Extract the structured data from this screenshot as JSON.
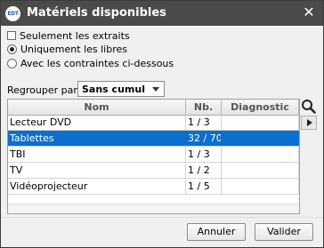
{
  "dialog": {
    "title": "Matériels disponibles",
    "app_icon_label": "EDT",
    "close_glyph": "✕"
  },
  "filters": {
    "only_extracts": {
      "label": "Seulement les extraits",
      "checked": false
    },
    "only_free": {
      "label": "Uniquement les libres",
      "selected": true
    },
    "with_constraints": {
      "label": "Avec les contraintes ci-dessous",
      "selected": false
    }
  },
  "grouping": {
    "label": "Regrouper par :",
    "selected": "Sans cumul"
  },
  "table": {
    "columns": [
      "Nom",
      "Nb.",
      "Diagnostic"
    ],
    "rows": [
      {
        "name": "Lecteur DVD",
        "nb": "1 / 3",
        "diagnostic": "",
        "selected": false
      },
      {
        "name": "Tablettes",
        "nb": "32 / 70",
        "diagnostic": "",
        "selected": true
      },
      {
        "name": "TBI",
        "nb": "1 / 3",
        "diagnostic": "",
        "selected": false
      },
      {
        "name": "TV",
        "nb": "1 / 2",
        "diagnostic": "",
        "selected": false
      },
      {
        "name": "Vidéoprojecteur",
        "nb": "1 / 5",
        "diagnostic": "",
        "selected": false
      }
    ]
  },
  "side_tools": {
    "search_icon": "search-icon",
    "expand_icon": "play-arrow-icon"
  },
  "buttons": {
    "cancel": "Annuler",
    "ok": "Valider"
  },
  "colors": {
    "titlebar": "#4a4a4a",
    "selection": "#0a6fd0"
  }
}
